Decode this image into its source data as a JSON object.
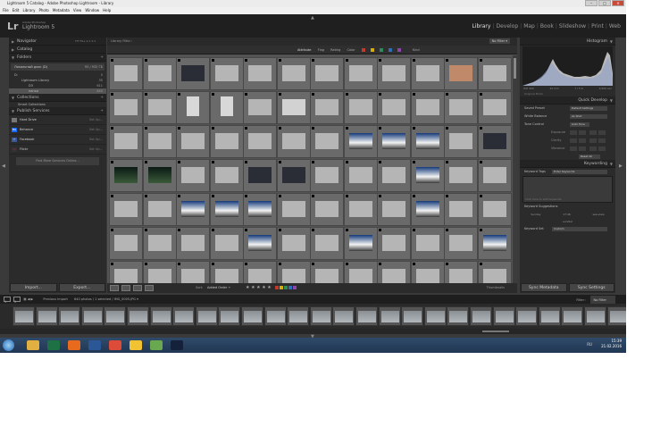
{
  "window": {
    "title": "Lightroom 5 Catalog - Adobe Photoshop Lightroom - Library",
    "min_label": "–",
    "max_label": "□",
    "close_label": "✕"
  },
  "menu": [
    "File",
    "Edit",
    "Library",
    "Photo",
    "Metadata",
    "View",
    "Window",
    "Help"
  ],
  "identity": {
    "logo": "Lr",
    "vendor": "Adobe Photoshop",
    "product": "Lightroom 5"
  },
  "modules": {
    "active": "Library",
    "items": [
      "Library",
      "Develop",
      "Map",
      "Book",
      "Slideshow",
      "Print",
      "Web"
    ],
    "separator": "|"
  },
  "arrows": {
    "up": "▲",
    "down": "▼",
    "left": "◀",
    "right": "▶"
  },
  "left": {
    "navigator": {
      "title": "Navigator",
      "zoom": "FIT FILL 1:1 3:1"
    },
    "catalog": {
      "title": "Catalog"
    },
    "folders": {
      "title": "Folders",
      "volume": {
        "name": "Локальный диск (D)",
        "size": "93 / 932 ГБ"
      },
      "items": [
        {
          "label": "D:",
          "count": "0"
        },
        {
          "label": "Lightroom Library",
          "count": "35"
        },
        {
          "label": "D3",
          "count": "611"
        },
        {
          "label": "папка",
          "count": "640"
        }
      ]
    },
    "collections": {
      "title": "Collections",
      "items": [
        "Smart Collections"
      ]
    },
    "publish": {
      "title": "Publish Services",
      "items": [
        {
          "icon": "hard-drive-icon",
          "label": "Hard Drive",
          "action": "Set Up..."
        },
        {
          "icon": "behance-icon",
          "glyph": "Bē",
          "label": "Behance",
          "action": "Set Up..."
        },
        {
          "icon": "facebook-icon",
          "glyph": "f",
          "label": "Facebook",
          "action": "Set Up..."
        },
        {
          "icon": "flickr-icon",
          "glyph": "••",
          "label": "Flickr",
          "action": "Set Up..."
        }
      ],
      "find_more": "Find More Services Online..."
    },
    "import_label": "Import...",
    "export_label": "Export..."
  },
  "filter_bar": {
    "title": "Library Filter :",
    "tabs": [
      "Text",
      "Attribute",
      "Metadata",
      "None"
    ],
    "active_tab": "Attribute",
    "preset": "No Filter ▾"
  },
  "attribute_bar": {
    "label": "Attribute",
    "flag": "Flag",
    "rating": "Rating",
    "color": "Color",
    "kind": "Kind",
    "swatches": [
      "#c0392b",
      "#d4ac0d",
      "#2e8b57",
      "#2e6eb5",
      "#8e44ad"
    ]
  },
  "grid": {
    "rows": [
      [
        "gray",
        "gray",
        "dark",
        "gray",
        "gray",
        "gray",
        "gray",
        "gray",
        "gray",
        "gray",
        "face",
        "gray"
      ],
      [
        "gray",
        "gray",
        "tall",
        "tall",
        "gray",
        "pale",
        "gray",
        "gray",
        "gray",
        "gray",
        "gray",
        "gray"
      ],
      [
        "gray",
        "gray",
        "gray",
        "gray",
        "gray",
        "gray",
        "gray",
        "blue",
        "blue",
        "blue",
        "gray",
        "dark"
      ],
      [
        "night",
        "night",
        "gray",
        "gray",
        "dark",
        "dark",
        "gray",
        "gray",
        "gray",
        "blue",
        "gray",
        "gray"
      ],
      [
        "gray",
        "gray",
        "blue",
        "blue",
        "blue",
        "gray",
        "gray",
        "gray",
        "gray",
        "blue",
        "gray",
        "gray"
      ],
      [
        "gray",
        "gray",
        "gray",
        "gray",
        "blue",
        "gray",
        "gray",
        "blue",
        "gray",
        "gray",
        "gray",
        "blue"
      ],
      [
        "gray",
        "gray",
        "gray",
        "gray",
        "gray",
        "gray",
        "gray",
        "gray",
        "gray",
        "gray",
        "gray",
        "gray"
      ]
    ]
  },
  "toolbar": {
    "sort_label": "Sort:",
    "sort_value": "Added Order ÷",
    "stars": "★ ★ ★ ★ ★",
    "thumbnails_label": "Thumbnails",
    "label_swatches": [
      "#c0392b",
      "#d4ac0d",
      "#2e8b57",
      "#2e6eb5",
      "#8e44ad"
    ]
  },
  "right": {
    "histogram": {
      "title": "Histogram",
      "readout": [
        "ISO 400",
        "40 mm",
        "f / 5.6",
        "1/400 sec"
      ],
      "original_photo": "Original Photo"
    },
    "quick_develop": {
      "title": "Quick Develop",
      "saved_preset_label": "Saved Preset",
      "saved_preset_value": "Default Settings",
      "white_balance_label": "White Balance",
      "white_balance_value": "As Shot",
      "tone_control_label": "Tone Control",
      "tone_control_value": "Auto Tone",
      "exposure_label": "Exposure",
      "clarity_label": "Clarity",
      "vibrance_label": "Vibrance",
      "reset_label": "Reset All"
    },
    "keywording": {
      "title": "Keywording",
      "tags_label": "Keyword Tags",
      "tags_value": "Enter Keywords",
      "click_here": "Click here to add keywords",
      "suggestions_label": "Keyword Suggestions",
      "suggestions": [
        "Sunday",
        "17:46",
        "sea-view",
        "sundial"
      ],
      "set_label": "Keyword Set",
      "set_value": "Custom"
    },
    "sync_metadata_label": "Sync Metadata",
    "sync_settings_label": "Sync Settings"
  },
  "filmstrip": {
    "page1": "1",
    "page2": "2",
    "source": "Previous Import",
    "count": "640 photos / 1 selected / IMG_0005.JPG ▾",
    "filter_label": "Filter :",
    "filter_value": "No Filter"
  },
  "taskbar": {
    "apps": [
      {
        "name": "taskbar-explorer-icon",
        "color": "#e2b040"
      },
      {
        "name": "taskbar-excel-icon",
        "color": "#1e7145"
      },
      {
        "name": "taskbar-firefox-icon",
        "color": "#e76a1d"
      },
      {
        "name": "taskbar-word-icon",
        "color": "#2b5797"
      },
      {
        "name": "taskbar-chrome-icon",
        "color": "#dd4b39"
      },
      {
        "name": "taskbar-folder-icon",
        "color": "#f1c232"
      },
      {
        "name": "taskbar-utorrent-icon",
        "color": "#6aa84f"
      },
      {
        "name": "taskbar-lightroom-icon",
        "color": "#15213a"
      }
    ],
    "lang": "RU",
    "time": "15:39",
    "date": "21.02.2016"
  }
}
